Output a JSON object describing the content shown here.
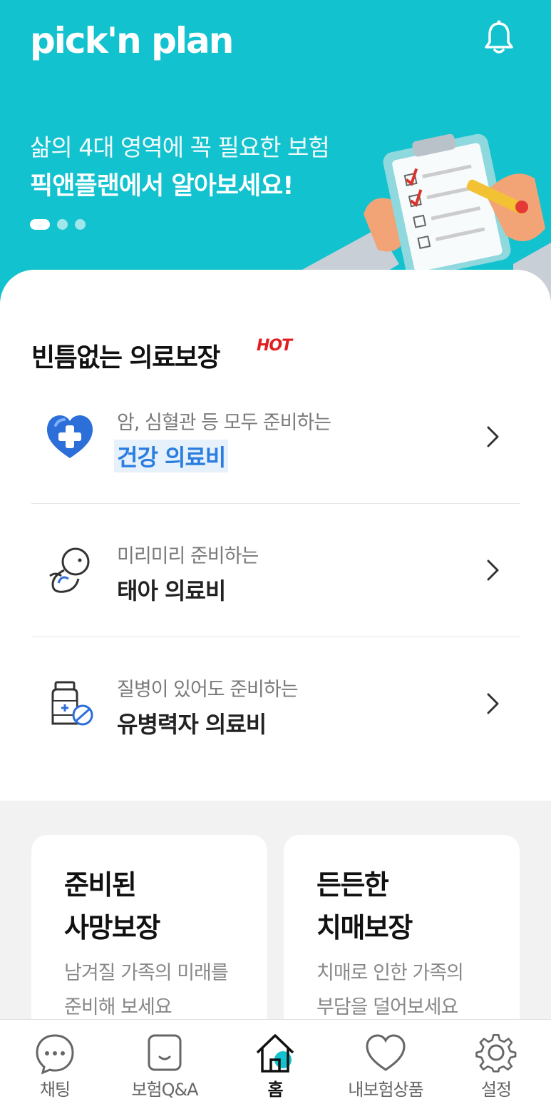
{
  "header": {
    "logo_text": "pick'n plan",
    "banner_line1": "삶의 4대 영역에 꼭 필요한 보험",
    "banner_line2": "픽앤플랜에서 알아보세요!",
    "carousel_count": 3,
    "carousel_active": 1,
    "accent_color": "#12c2cf"
  },
  "medical": {
    "title": "빈틈없는 의료보장",
    "badge": "HOT",
    "items": [
      {
        "subtitle": "암, 심혈관 등 모두 준비하는",
        "title": "건강 의료비",
        "icon": "heart-cross-icon",
        "highlighted": true
      },
      {
        "subtitle": "미리미리 준비하는",
        "title": "태아 의료비",
        "icon": "fetus-icon",
        "highlighted": false
      },
      {
        "subtitle": "질병이 있어도 준비하는",
        "title": "유병력자 의료비",
        "icon": "medicine-bottle-icon",
        "highlighted": false
      }
    ]
  },
  "cards": [
    {
      "title": "준비된\n사망보장",
      "desc": "남겨질 가족의 미래를\n준비해 보세요"
    },
    {
      "title": "든든한\n치매보장",
      "desc": "치매로 인한 가족의\n부담을 덜어보세요"
    }
  ],
  "tabs": [
    {
      "label": "채팅",
      "icon": "chat-icon"
    },
    {
      "label": "보험Q&A",
      "icon": "qa-icon"
    },
    {
      "label": "홈",
      "icon": "home-icon",
      "active": true
    },
    {
      "label": "내보험상품",
      "icon": "heart-icon"
    },
    {
      "label": "설정",
      "icon": "gear-icon"
    }
  ]
}
